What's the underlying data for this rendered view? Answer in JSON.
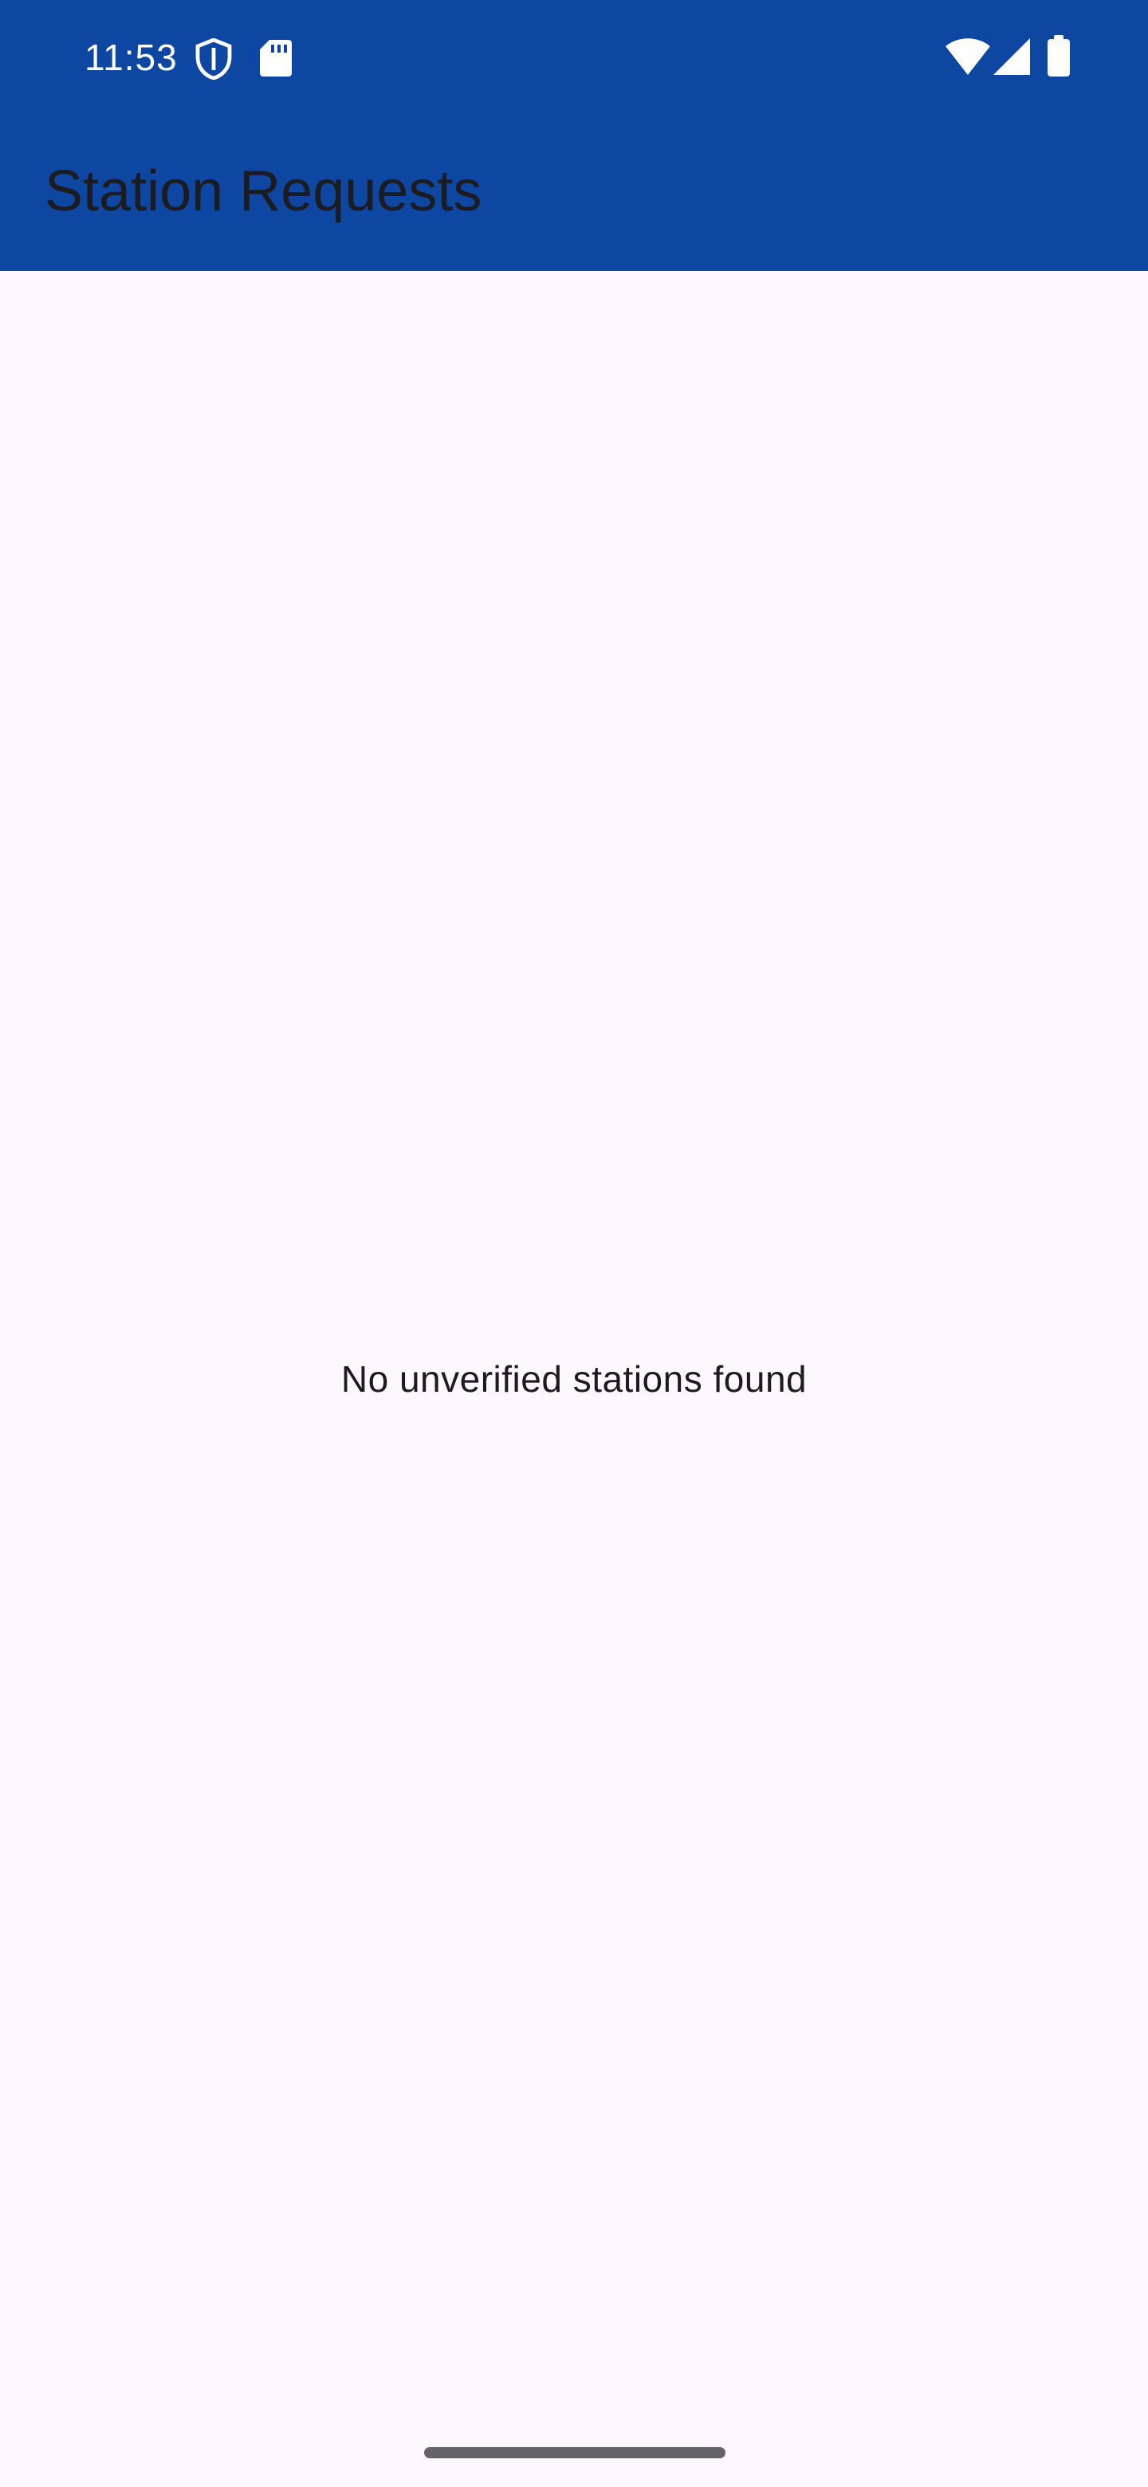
{
  "status_bar": {
    "time": "11:53",
    "icons": [
      "shield-icon",
      "sd-card-icon",
      "wifi-icon",
      "cell-signal-icon",
      "battery-icon"
    ],
    "background_color": "#0d47a1"
  },
  "app_bar": {
    "title": "Station Requests",
    "background_color": "#0d47a1"
  },
  "main": {
    "empty_message": "No unverified stations found",
    "background_color": "#fdf7fe"
  }
}
